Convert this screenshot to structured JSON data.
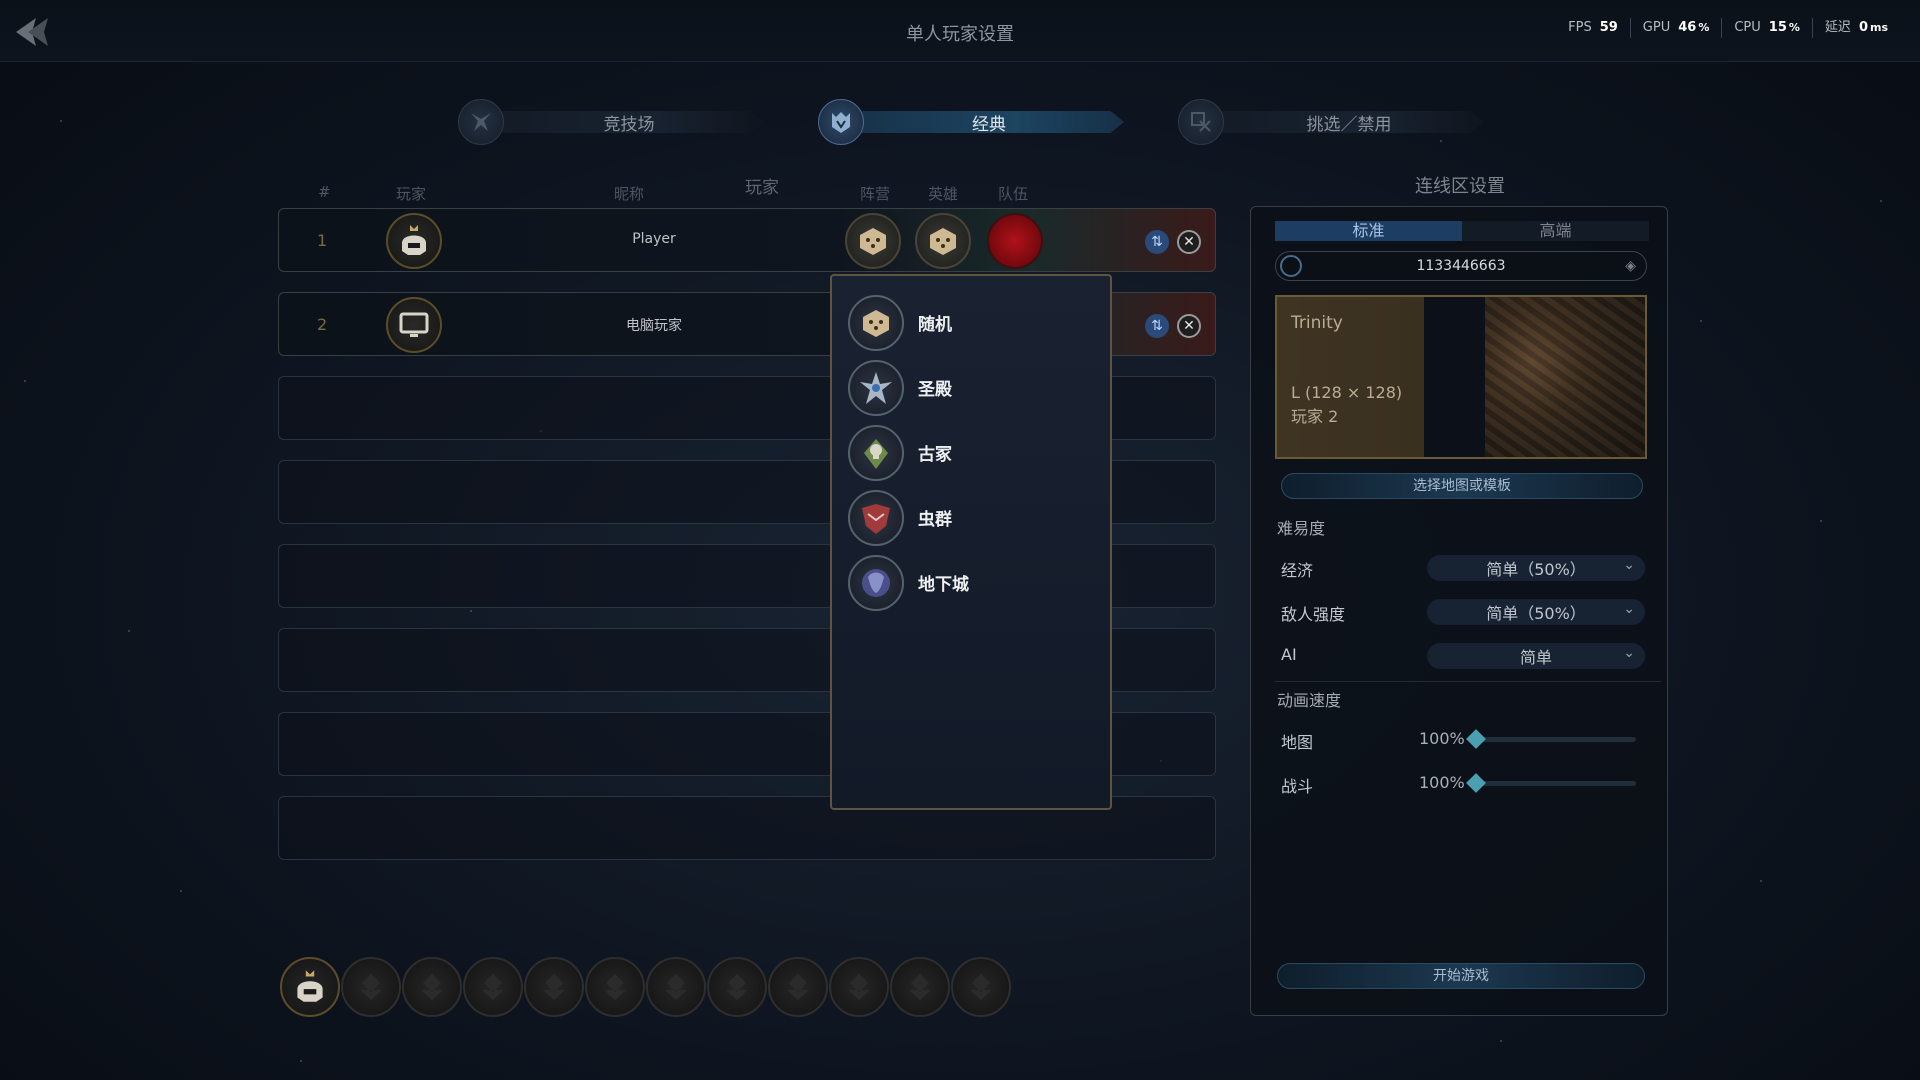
{
  "header": {
    "title": "单人玩家设置",
    "stats": [
      {
        "label": "FPS",
        "value": "59",
        "unit": ""
      },
      {
        "label": "GPU",
        "value": "46",
        "unit": "%"
      },
      {
        "label": "CPU",
        "value": "15",
        "unit": "%"
      },
      {
        "label": "延迟",
        "value": "0",
        "unit": "ms"
      }
    ]
  },
  "mode_tabs": [
    {
      "label": "竞技场",
      "active": false
    },
    {
      "label": "经典",
      "active": true
    },
    {
      "label": "挑选／禁用",
      "active": false
    }
  ],
  "table": {
    "section_label": "玩家",
    "columns": {
      "num": "#",
      "player": "玩家",
      "nick": "昵称",
      "faction": "阵营",
      "hero": "英雄",
      "team": "队伍"
    },
    "rows": [
      {
        "num": "1",
        "nickname": "Player",
        "avatar_icon": "crowned-helmet-icon"
      },
      {
        "num": "2",
        "nickname": "电脑玩家",
        "avatar_icon": "monitor-icon"
      }
    ],
    "empty_slots": 6,
    "team_color": "#b0121a"
  },
  "faction_dropdown": {
    "items": [
      {
        "label": "随机",
        "icon": "dice-icon"
      },
      {
        "label": "圣殿",
        "icon": "temple-emblem-icon"
      },
      {
        "label": "古冢",
        "icon": "necropolis-emblem-icon"
      },
      {
        "label": "虫群",
        "icon": "hive-emblem-icon"
      },
      {
        "label": "地下城",
        "icon": "dungeon-emblem-icon"
      }
    ]
  },
  "settings": {
    "title": "连线区设置",
    "segments": [
      "标准",
      "高端"
    ],
    "active_segment": 0,
    "seed": "1133446663",
    "map": {
      "name": "Trinity",
      "size": "L (128 × 128)",
      "players": "玩家 2"
    },
    "select_map_button": "选择地图或模板",
    "difficulty": {
      "label": "难易度",
      "options": [
        {
          "label": "经济",
          "value": "简单（50%）"
        },
        {
          "label": "敌人强度",
          "value": "简单（50%）"
        },
        {
          "label": "AI",
          "value": "简单"
        }
      ]
    },
    "animation": {
      "label": "动画速度",
      "sliders": [
        {
          "label": "地图",
          "value_text": "100%",
          "value": 0
        },
        {
          "label": "战斗",
          "value_text": "100%",
          "value": 0
        }
      ]
    },
    "start_button": "开始游戏"
  },
  "colors": {
    "accent": "#4aa0b0",
    "gold": "#6b5a35"
  }
}
